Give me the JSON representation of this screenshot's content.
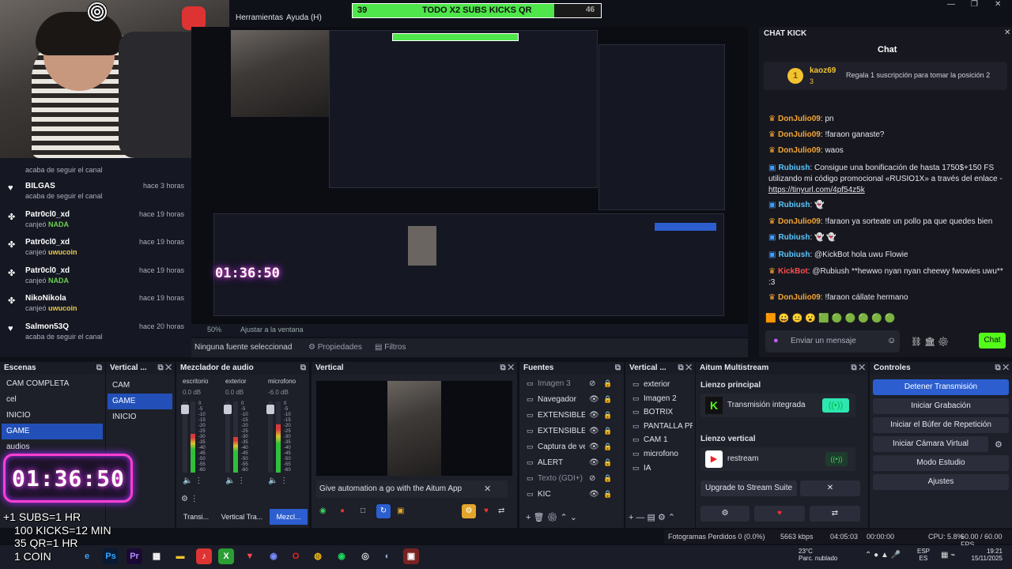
{
  "menu": {
    "herramientas": "Herramientas",
    "ayuda": "Ayuda (H)"
  },
  "goal": {
    "left": "39",
    "text": "TODO X2 SUBS KICKS QR",
    "right": "46"
  },
  "activity": [
    {
      "user": "BILGAS",
      "sub": "acaba de seguir el canal",
      "time": "hace 3 horas",
      "icon": "heart-icon"
    },
    {
      "user": "Patr0cl0_xd",
      "sub": "canjeó NADA",
      "time": "hace 19 horas",
      "icon": "points-icon",
      "prefix": "canjeó ",
      "reward": "NADA",
      "color": "#6cd04f"
    },
    {
      "user": "Patr0cl0_xd",
      "sub": "canjeó uwucoin",
      "time": "hace 19 horas",
      "icon": "points-icon",
      "prefix": "canjeó ",
      "reward": "uwucoin",
      "color": "#e8c94a"
    },
    {
      "user": "Patr0cl0_xd",
      "sub": "canjeó NADA",
      "time": "hace 19 horas",
      "icon": "points-icon",
      "prefix": "canjeó ",
      "reward": "NADA",
      "color": "#6cd04f"
    },
    {
      "user": "NikoNikola",
      "sub": "canjeó uwucoin",
      "time": "hace 19 horas",
      "icon": "points-icon",
      "prefix": "canjeó ",
      "reward": "uwucoin",
      "color": "#e8c94a"
    },
    {
      "user": "Salmon53Q",
      "sub": "acaba de seguir el canal",
      "time": "hace 20 horas",
      "icon": "heart-icon"
    }
  ],
  "activity_top_sub": "acaba de seguir el canal",
  "zoom": {
    "pct": "50%",
    "fit": "Ajustar a la ventana"
  },
  "source_bar": {
    "none": "Ninguna fuente seleccionad",
    "props": "Propiedades",
    "filters": "Filtros"
  },
  "chat": {
    "window_title": "CHAT KICK",
    "title": "Chat",
    "pin_user": "kaoz69",
    "pin_count": "3",
    "pin_text": "Regala 1 suscripción para tomar la posición 2",
    "messages": [
      {
        "user": "DonJulio09",
        "color": "o",
        "text": "pn"
      },
      {
        "user": "DonJulio09",
        "color": "o",
        "text": "!faraon ganaste?"
      },
      {
        "user": "DonJulio09",
        "color": "o",
        "text": "waos"
      },
      {
        "user": "Rubiush",
        "color": "b",
        "text": "Consigue una bonificación de hasta 1750$+150 FS utilizando mi código promocional «RUSIO1X» a través del enlace -",
        "link": "https://tinyurl.com/4pf54z5k"
      },
      {
        "user": "Rubiush",
        "color": "b",
        "text": "👻"
      },
      {
        "user": "DonJulio09",
        "color": "o",
        "text": "!faraon ya sorteate un pollo pa que quedes bien"
      },
      {
        "user": "Rubiush",
        "color": "b",
        "text": "👻 👻"
      },
      {
        "user": "Rubiush",
        "color": "b",
        "text": "@KickBot hola uwu Flowie"
      },
      {
        "user": "KickBot",
        "color": "r",
        "text": "@Rubiush **hewwo nyan nyan cheewy fwowies uwu** :3"
      },
      {
        "user": "DonJulio09",
        "color": "o",
        "text": "!faraon cállate hermano"
      }
    ],
    "input_placeholder": "Enviar un mensaje",
    "send": "Chat"
  },
  "docks": {
    "scenes_title": "Escenas",
    "scenes": [
      "CAM COMPLETA",
      "cel",
      "INICIO",
      "GAME",
      "audios"
    ],
    "scenes_selected": "GAME",
    "vert_title": "Vertical ...",
    "vert_scenes": [
      "CAM",
      "GAME",
      "INICIO"
    ],
    "mixer_title": "Mezclador de audio",
    "mixer": [
      {
        "name": "escritorio",
        "db": "0.0 dB"
      },
      {
        "name": "exterior",
        "db": "0.0 dB"
      },
      {
        "name": "microfono",
        "db": "-6.0 dB"
      }
    ],
    "ticks": [
      "0",
      "-5",
      "-10",
      "-15",
      "-20",
      "-25",
      "-30",
      "-35",
      "-40",
      "-45",
      "-50",
      "-55",
      "-60"
    ],
    "preview_title": "Vertical",
    "preview_banner": "Give automation a go with the Aitum App",
    "sources_title": "Fuentes",
    "sources": [
      "Imagen 3",
      "Navegador",
      "EXTENSIBLE LE",
      "EXTENSIBLE",
      "Captura de ven",
      "ALERT",
      "Texto (GDI+)",
      "KIC"
    ],
    "vsrc_title": "Vertical ...",
    "vsources": [
      "exterior",
      "Imagen 2",
      "BOTRIX",
      "PANTALLA PRIN",
      "CAM 1",
      "microfono",
      "IA"
    ],
    "aitum_title": "Aitum Multistream",
    "lienzo_principal": "Lienzo principal",
    "integrada": "Transmisión integrada",
    "lienzo_vertical": "Lienzo vertical",
    "restream": "restream",
    "upgrade": "Upgrade to Stream Suite",
    "controls_title": "Controles",
    "controls": [
      "Detener Transmisión",
      "Iniciar Grabación",
      "Iniciar el Búfer de Repetición",
      "Iniciar Cámara Virtual",
      "Modo Estudio",
      "Ajustes"
    ],
    "tabs": [
      "Transi...",
      "Vertical Tra...",
      "Mezcl..."
    ]
  },
  "overlay": {
    "timer": "01:36:50",
    "rules": [
      "+1 SUBS=1 HR",
      "100 KICKS=12 MIN",
      "35 QR=1 HR",
      "1 COIN"
    ]
  },
  "status": {
    "frames": "Fotogramas Perdidos 0 (0.0%)",
    "kbps": "5663 kbps",
    "live": "04:05:03",
    "rec": "00:00:00",
    "cpu": "CPU: 5.8%",
    "fps": "60.00 / 60.00 FPS"
  },
  "taskbar": {
    "weather_temp": "23°C",
    "weather_desc": "Parc. nublado",
    "lang1": "ESP",
    "lang2": "ES",
    "time": "19:21",
    "date": "15/11/2025"
  },
  "colors": {
    "accent": "#2c5ecf",
    "kick": "#53fc18",
    "bg": "#0f1118"
  }
}
